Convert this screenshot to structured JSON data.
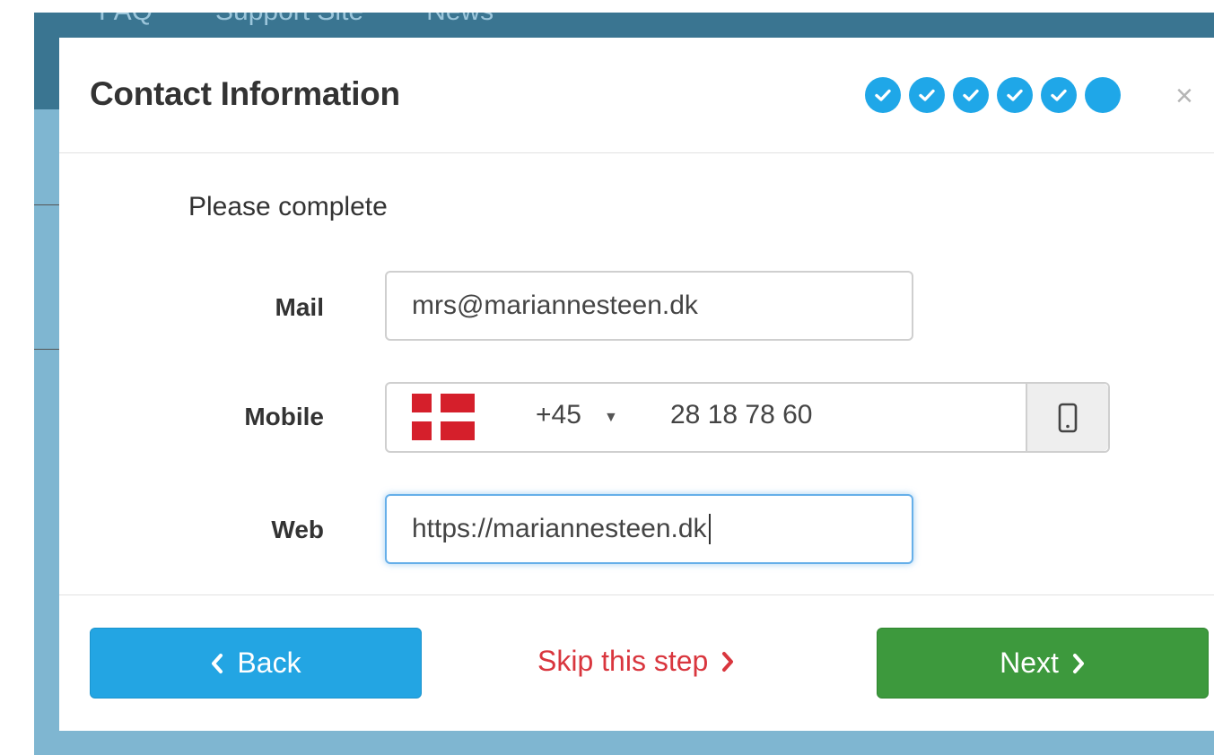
{
  "background_nav": [
    "FAQ",
    "Support Site",
    "News"
  ],
  "modal": {
    "title": "Contact Information",
    "steps": {
      "completed": 5,
      "total": 6
    },
    "close_label": "×"
  },
  "form": {
    "intro": "Please complete",
    "mail": {
      "label": "Mail",
      "value": "mrs@mariannesteen.dk"
    },
    "mobile": {
      "label": "Mobile",
      "country_flag": "denmark-flag-icon",
      "dial_code": "+45",
      "value": "28 18 78 60",
      "addon_icon": "mobile-phone-icon"
    },
    "web": {
      "label": "Web",
      "value": "https://mariannesteen.dk"
    }
  },
  "footer": {
    "back_label": "Back",
    "skip_label": "Skip this step",
    "next_label": "Next"
  },
  "colors": {
    "accent": "#1fa7e8",
    "success": "#3d993d",
    "danger": "#d9363e"
  }
}
